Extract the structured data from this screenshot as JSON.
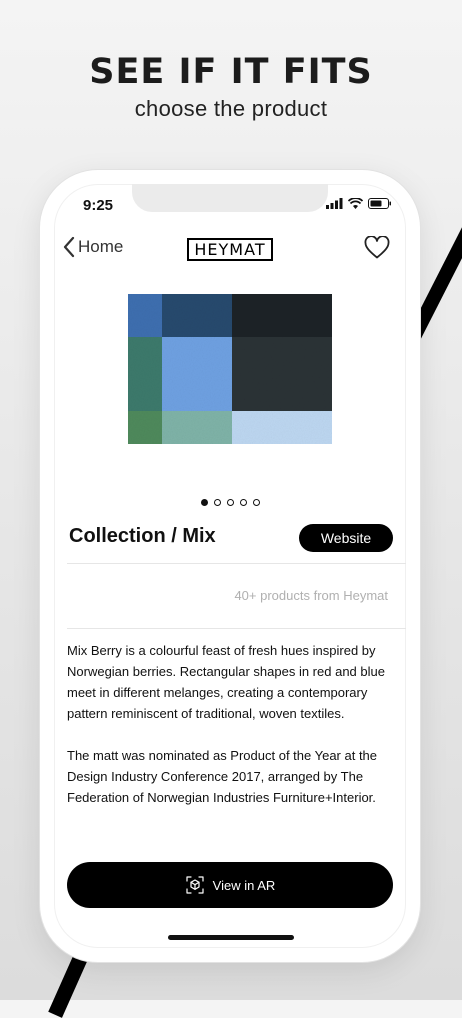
{
  "headline": "SEE IF IT FITS",
  "subheadline": "choose the product",
  "status_bar": {
    "time": "9:25"
  },
  "nav": {
    "back_label": "Home",
    "logo_text": "HEYMAT"
  },
  "carousel": {
    "slide_count": 5,
    "active_index": 0
  },
  "product": {
    "title": "Collection / Mix",
    "website_label": "Website",
    "products_link": "40+ products from Heymat",
    "description": [
      "Mix Berry is a colourful feast of fresh hues inspired by Norwegian berries. Rectangular shapes in red and blue meet in different melanges, creating a contemporary pattern reminiscent of traditional, woven textiles.",
      "The matt was nominated as Product of the Year at the Design Industry Conference 2017, arranged by The Federation of Norwegian Industries Furniture+Interior."
    ]
  },
  "ar_button": {
    "label": "View in AR",
    "icon": "ar-cube-icon"
  },
  "colors": {
    "accent": "#000000",
    "background": "#ececec"
  }
}
